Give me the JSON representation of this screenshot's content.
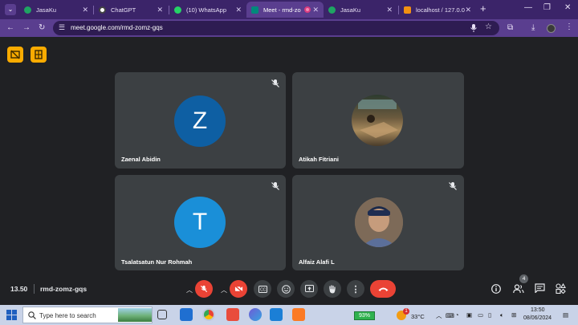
{
  "browser": {
    "tabs": [
      {
        "label": "JasaKu",
        "favicon_color": "#1fa463"
      },
      {
        "label": "ChatGPT",
        "favicon_color": "#ffffff"
      },
      {
        "label": "(10) WhatsApp",
        "favicon_color": "#25d366"
      },
      {
        "label": "Meet - rmd-zo",
        "favicon_color": "#00897b"
      },
      {
        "label": "JasaKu",
        "favicon_color": "#1fa463"
      },
      {
        "label": "localhost / 127.0.0",
        "favicon_color": "#f29111"
      }
    ],
    "url": "meet.google.com/rmd-zomz-gqs"
  },
  "meet": {
    "participants": [
      {
        "name": "Zaenal Abidin",
        "initial": "Z",
        "avatar_color": "#0e5fa3"
      },
      {
        "name": "Atikah Fitriani",
        "initial": "",
        "avatar_color": "#6b5a3e"
      },
      {
        "name": "Tsalatsatun Nur Rohmah",
        "initial": "T",
        "avatar_color": "#1a8fd8"
      },
      {
        "name": "Alfaiz Alafi L",
        "initial": "",
        "avatar_color": "#7d6a58"
      }
    ],
    "time": "13.50",
    "meeting_code": "rmd-zomz-gqs",
    "people_count": "4"
  },
  "taskbar": {
    "search_placeholder": "Type here to search",
    "battery": "93%",
    "weather_temp": "33°C",
    "weather_badge": "1",
    "clock_time": "13:50",
    "clock_date": "08/06/2024"
  },
  "colors": {
    "tab_strip": "#3b2469",
    "toolbar": "#5a3e8f",
    "meet_bg": "#202124",
    "tile_bg": "#3c4043",
    "end_call": "#ea4335"
  }
}
